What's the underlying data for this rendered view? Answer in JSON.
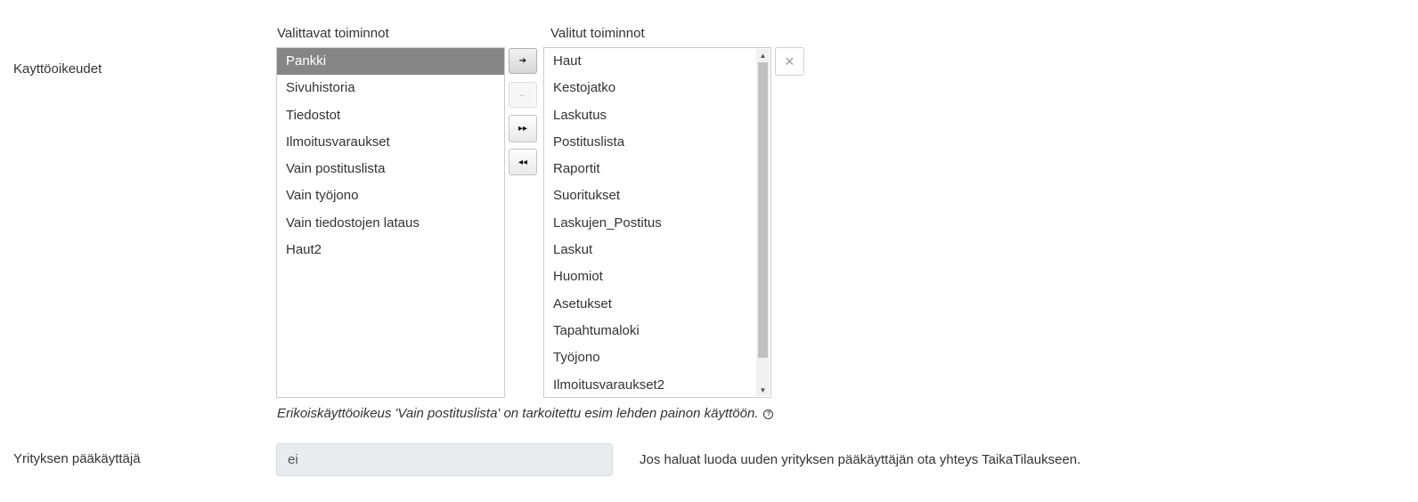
{
  "permissions": {
    "label": "Kayttöoikeudet",
    "available": {
      "title": "Valittavat toiminnot",
      "items": [
        "Pankki",
        "Sivuhistoria",
        "Tiedostot",
        "Ilmoitusvaraukset",
        "Vain postituslista",
        "Vain työjono",
        "Vain tiedostojen lataus",
        "Haut2"
      ],
      "selected_item": "Pankki"
    },
    "chosen": {
      "title": "Valitut toiminnot",
      "items": [
        "Haut",
        "Kestojatko",
        "Laskutus",
        "Postituslista",
        "Raportit",
        "Suoritukset",
        "Laskujen_Postitus",
        "Laskut",
        "Huomiot",
        "Asetukset",
        "Tapahtumaloki",
        "Työjono",
        "Ilmoitusvaraukset2"
      ]
    },
    "buttons": {
      "move_right": "➔",
      "move_left": "←",
      "move_all_right": "▸▸",
      "move_all_left": "◂◂",
      "clear": "×"
    },
    "icons": {
      "move_right": "arrow-right-icon",
      "move_left": "arrow-left-icon",
      "move_all_right": "double-arrow-right-icon",
      "move_all_left": "double-arrow-left-icon",
      "clear": "close-icon",
      "help": "question-circle-icon"
    },
    "note": "Erikoiskäyttöoikeus 'Vain postituslista' on tarkoitettu esim lehden painon käyttöön.",
    "help_glyph": "?"
  },
  "main_user": {
    "label": "Yrityksen pääkäyttäjä",
    "value": "ei",
    "info": "Jos haluat luoda uuden yrityksen pääkäyttäjän ota yhteys TaikaTilaukseen."
  },
  "colors": {
    "selected_row": "#868686",
    "input_readonly_bg": "#e9ecef",
    "border": "#cccccc"
  }
}
